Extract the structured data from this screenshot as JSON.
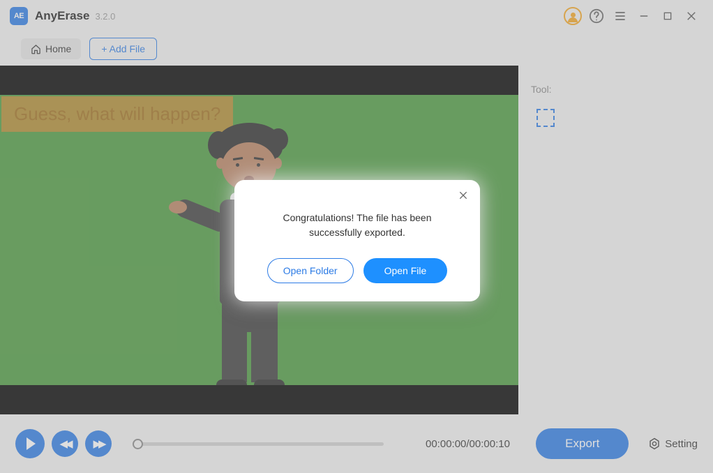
{
  "app": {
    "name": "AnyErase",
    "version": "3.2.0",
    "logo_text": "AE"
  },
  "titlebar_icons": {
    "account": "account-icon",
    "help": "help-icon",
    "menu": "menu-icon",
    "minimize": "minimize-icon",
    "maximize": "maximize-icon",
    "close": "close-icon"
  },
  "toolbar": {
    "home": "Home",
    "add_file": "+ Add File"
  },
  "video": {
    "caption": "Guess, what will happen?"
  },
  "side": {
    "tool_label": "Tool:",
    "tools": [
      "selection-crop"
    ]
  },
  "playback": {
    "current": "00:00:00",
    "total": "00:00:10",
    "timecode": "00:00:00/00:00:10"
  },
  "footer": {
    "export": "Export",
    "setting": "Setting"
  },
  "modal": {
    "message": "Congratulations! The file has been successfully exported.",
    "open_folder": "Open Folder",
    "open_file": "Open File"
  },
  "colors": {
    "accent": "#2c7be5",
    "video_bg": "#4b9a3e",
    "caption_bg": "#b08a2e"
  }
}
